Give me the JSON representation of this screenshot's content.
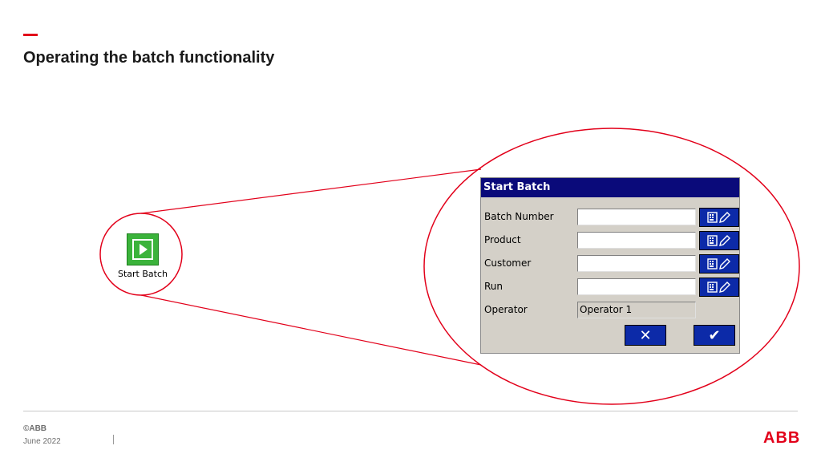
{
  "slide": {
    "title": "Operating the batch functionality",
    "accent_color": "#e2001a"
  },
  "start_batch_icon": {
    "label": "Start Batch",
    "icon": "play-icon",
    "color": "#3bb33b"
  },
  "dialog": {
    "title": "Start Batch",
    "fields": [
      {
        "label": "Batch Number",
        "value": "",
        "editable": true
      },
      {
        "label": "Product",
        "value": "",
        "editable": true
      },
      {
        "label": "Customer",
        "value": "",
        "editable": true
      },
      {
        "label": "Run",
        "value": "",
        "editable": true
      },
      {
        "label": "Operator",
        "value": "Operator 1",
        "editable": false
      }
    ],
    "keyboard_button_icon": "keyboard-edit-icon",
    "cancel_symbol": "✕",
    "confirm_symbol": "✔"
  },
  "footer": {
    "copyright": "©ABB",
    "date": "June 2022",
    "logo_text": "ABB"
  }
}
